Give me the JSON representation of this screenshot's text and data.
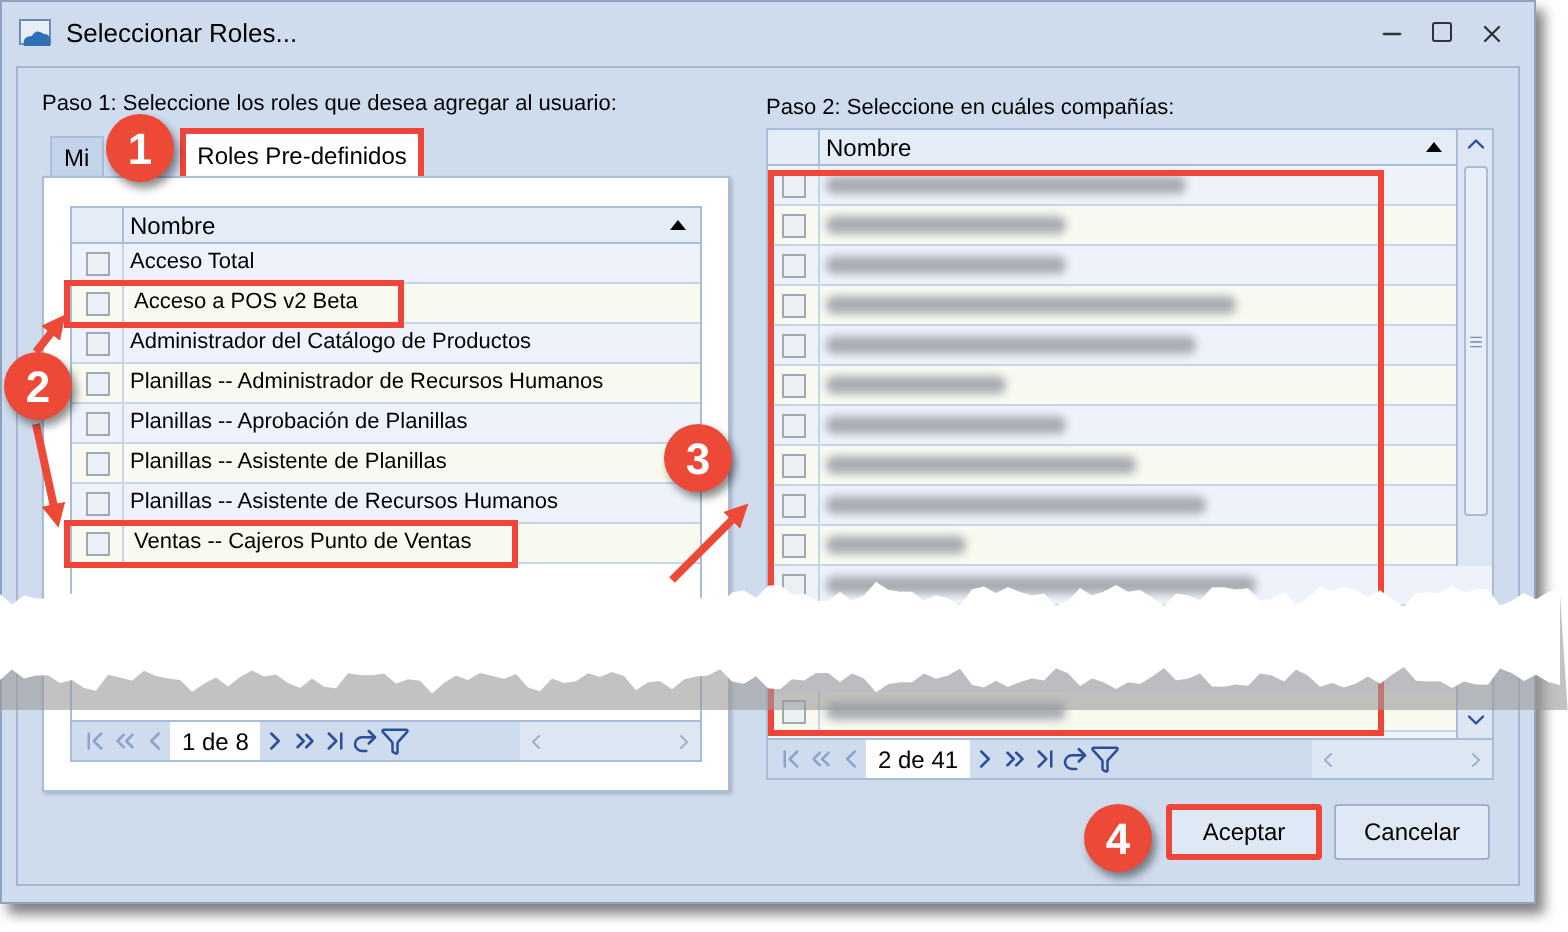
{
  "window": {
    "title": "Seleccionar Roles..."
  },
  "step1": {
    "label": "Paso 1: Seleccione los roles que desea agregar al usuario:",
    "tabs": [
      {
        "label": "Mi",
        "selected": false,
        "highlighted": false
      },
      {
        "label": "Roles Pre-definidos",
        "selected": true,
        "highlighted": true
      }
    ],
    "grid": {
      "column": "Nombre",
      "rows": [
        {
          "name": "Acceso Total",
          "checked": false,
          "highlighted": false
        },
        {
          "name": "Acceso a POS v2 Beta",
          "checked": false,
          "highlighted": true
        },
        {
          "name": "Administrador del Catálogo de Productos",
          "checked": false,
          "highlighted": false
        },
        {
          "name": "Planillas -- Administrador de Recursos Humanos",
          "checked": false,
          "highlighted": false
        },
        {
          "name": "Planillas -- Aprobación de Planillas",
          "checked": false,
          "highlighted": false
        },
        {
          "name": "Planillas -- Asistente de Planillas",
          "checked": false,
          "highlighted": false
        },
        {
          "name": "Planillas -- Asistente de Recursos Humanos",
          "checked": false,
          "highlighted": false
        },
        {
          "name": "Ventas -- Cajeros Punto de Ventas",
          "checked": false,
          "highlighted": true
        }
      ],
      "pager": "1 de 8"
    }
  },
  "step2": {
    "label": "Paso 2: Seleccione en cuáles compañías:",
    "grid": {
      "column": "Nombre",
      "highlighted": true,
      "rows_top": [
        {
          "checked": false
        },
        {
          "checked": false
        },
        {
          "checked": false
        },
        {
          "checked": false
        },
        {
          "checked": false
        },
        {
          "checked": false
        },
        {
          "checked": false
        },
        {
          "checked": false
        },
        {
          "checked": false
        },
        {
          "checked": false
        },
        {
          "checked": false
        }
      ],
      "rows_bottom": [
        {
          "checked": false
        }
      ],
      "pager": "2 de 41"
    }
  },
  "buttons": [
    {
      "label": "Aceptar",
      "highlighted": true
    },
    {
      "label": "Cancelar",
      "highlighted": false
    }
  ],
  "callouts": [
    "1",
    "2",
    "3",
    "4"
  ]
}
